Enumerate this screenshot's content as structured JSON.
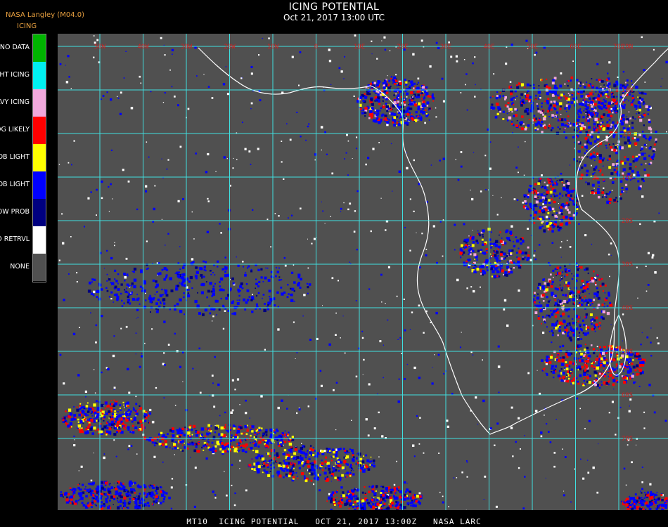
{
  "header": {
    "source": "NASA Langley (M04.0)",
    "product": "ICING",
    "title": "ICING POTENTIAL",
    "subtitle": "Oct 21, 2017 13:00 UTC"
  },
  "legend": [
    {
      "label": "NO DATA",
      "color": "#00b400"
    },
    {
      "label": "NIGHT ICING",
      "color": "#00f0f0"
    },
    {
      "label": "HEAVY ICING",
      "color": "#f0a8dc"
    },
    {
      "label": "MOG LIKELY",
      "color": "#ff0000"
    },
    {
      "label": "HI PROB LIGHT",
      "color": "#ffff00"
    },
    {
      "label": "LO PROB LIGHT",
      "color": "#0000ff"
    },
    {
      "label": "LOW PROB",
      "color": "#000080"
    },
    {
      "label": "NO RETRVL",
      "color": "#ffffff"
    },
    {
      "label": "NONE",
      "color": "#505050"
    }
  ],
  "grid": {
    "color": "#40e0e0",
    "label_color": "#d02020",
    "longitude_labels": [
      "50W",
      "40W",
      "30W",
      "20W",
      "10W",
      "0",
      "10E",
      "20E",
      "30E",
      "40E",
      "50E",
      "60E",
      "70E"
    ],
    "latitude_labels": [
      "20N",
      "10N",
      "EQ",
      "10S",
      "20S",
      "30S",
      "40S",
      "50S",
      "60S",
      "70S"
    ]
  },
  "map": {
    "background": "#505050",
    "coast_color": "#ffffff"
  },
  "footer": "MT10  ICING POTENTIAL   OCT 21, 2017 13:00Z   NASA LARC"
}
